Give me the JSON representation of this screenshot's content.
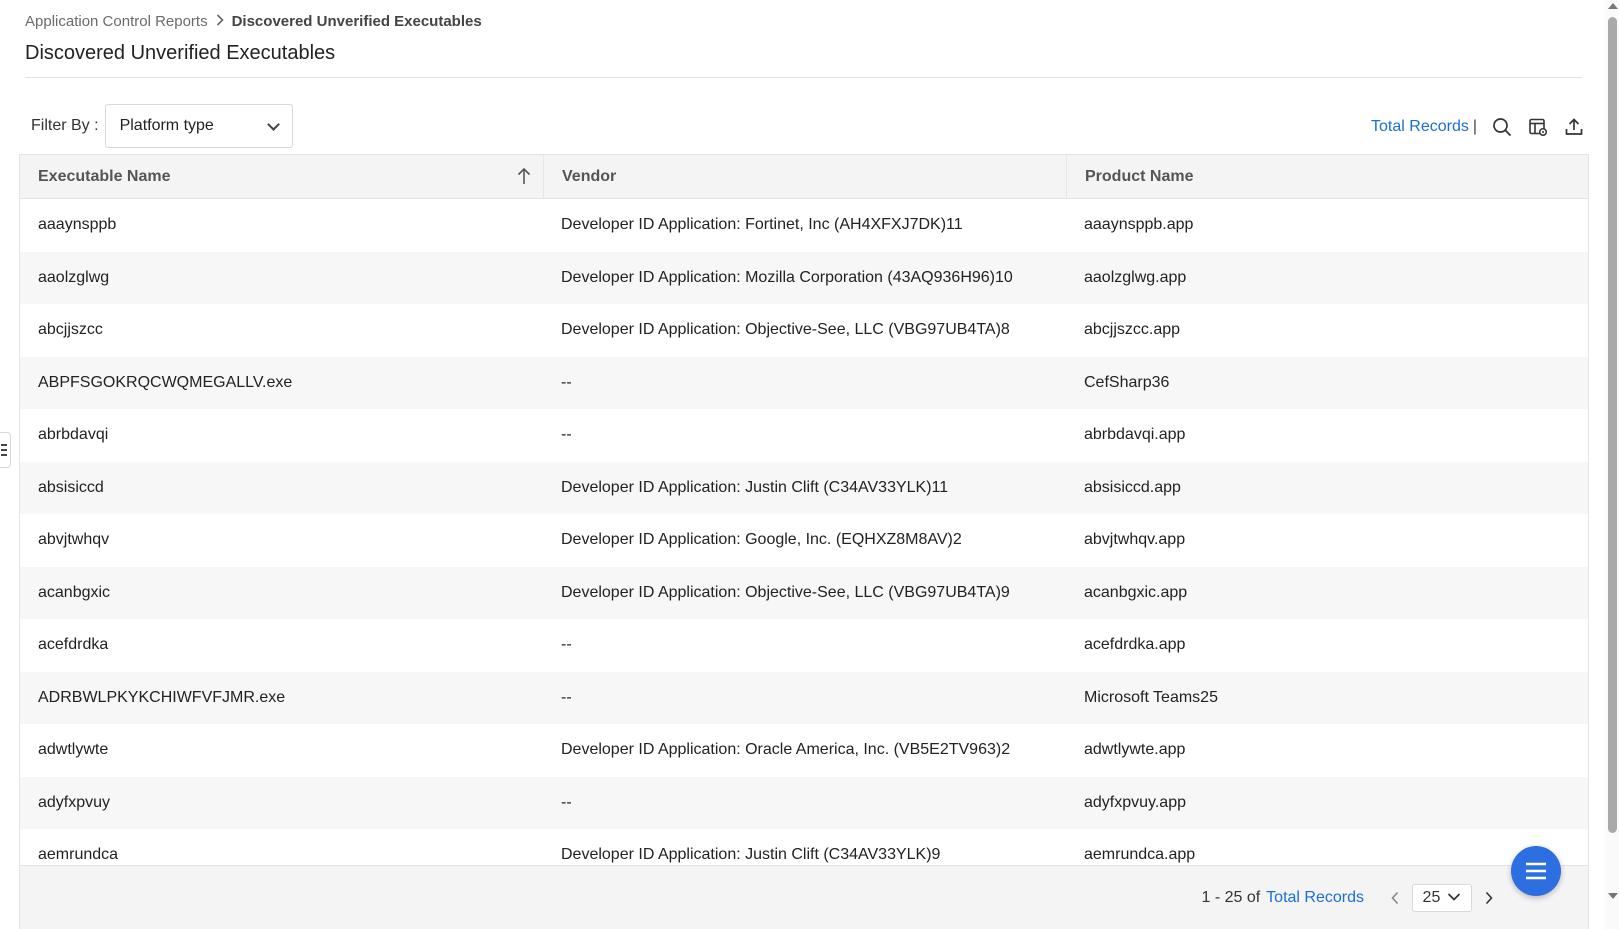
{
  "breadcrumb": {
    "parent": "Application Control Reports",
    "current": "Discovered Unverified Executables"
  },
  "page_title": "Discovered Unverified Executables",
  "filter": {
    "label": "Filter By :",
    "selected": "Platform type"
  },
  "toolbar": {
    "total_records_label": "Total Records",
    "separator": "|",
    "icons": [
      "search-icon",
      "column-settings-icon",
      "export-icon"
    ]
  },
  "table": {
    "columns": [
      "Executable Name",
      "Vendor",
      "Product Name"
    ],
    "sort": {
      "column": "Executable Name",
      "direction": "ascending"
    },
    "rows": [
      {
        "name": "aaaynsppb",
        "vendor": "Developer ID Application: Fortinet, Inc (AH4XFXJ7DK)11",
        "product": "aaaynsppb.app"
      },
      {
        "name": "aaolzglwg",
        "vendor": "Developer ID Application: Mozilla Corporation (43AQ936H96)10",
        "product": "aaolzglwg.app"
      },
      {
        "name": "abcjjszcc",
        "vendor": "Developer ID Application: Objective-See, LLC (VBG97UB4TA)8",
        "product": "abcjjszcc.app"
      },
      {
        "name": "ABPFSGOKRQCWQMEGALLV.exe",
        "vendor": "--",
        "product": "CefSharp36"
      },
      {
        "name": "abrbdavqi",
        "vendor": "--",
        "product": "abrbdavqi.app"
      },
      {
        "name": "absisiccd",
        "vendor": "Developer ID Application: Justin Clift (C34AV33YLK)11",
        "product": "absisiccd.app"
      },
      {
        "name": "abvjtwhqv",
        "vendor": "Developer ID Application: Google, Inc. (EQHXZ8M8AV)2",
        "product": "abvjtwhqv.app"
      },
      {
        "name": "acanbgxic",
        "vendor": "Developer ID Application: Objective-See, LLC (VBG97UB4TA)9",
        "product": "acanbgxic.app"
      },
      {
        "name": "acefdrdka",
        "vendor": "--",
        "product": "acefdrdka.app"
      },
      {
        "name": "ADRBWLPKYKCHIWFVFJMR.exe",
        "vendor": "--",
        "product": "Microsoft Teams25"
      },
      {
        "name": "adwtlywte",
        "vendor": "Developer ID Application: Oracle America, Inc. (VB5E2TV963)2",
        "product": "adwtlywte.app"
      },
      {
        "name": "adyfxpvuy",
        "vendor": "--",
        "product": "adyfxpvuy.app"
      },
      {
        "name": "aemrundca",
        "vendor": "Developer ID Application: Justin Clift (C34AV33YLK)9",
        "product": "aemrundca.app"
      }
    ]
  },
  "pagination": {
    "range_text": "1 - 25 of",
    "total_link": "Total Records",
    "page_size": "25"
  },
  "colors": {
    "link": "#1a6fd8",
    "header_bg": "#f4f4f5",
    "fab": "#2d6fe0"
  }
}
